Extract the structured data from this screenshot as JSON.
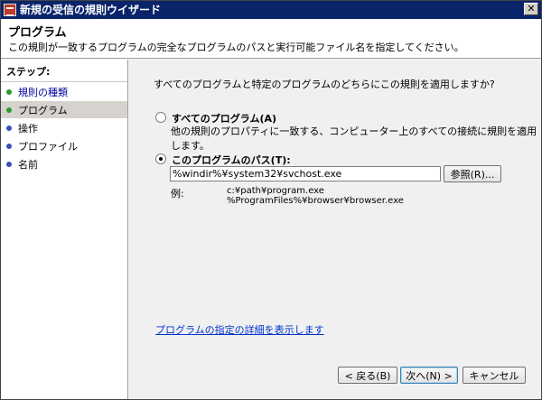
{
  "window": {
    "title": "新規の受信の規則ウイザード",
    "close_glyph": "✕"
  },
  "header": {
    "title": "プログラム",
    "description": "この規則が一致するプログラムの完全なプログラムのパスと実行可能ファイル名を指定してください。"
  },
  "steps": {
    "label": "ステップ:",
    "items": [
      {
        "label": "規則の種類",
        "state": "done",
        "color": "#2e9a2e"
      },
      {
        "label": "プログラム",
        "state": "current",
        "color": "#2e9a2e"
      },
      {
        "label": "操作",
        "state": "pending",
        "color": "#3a4fb8"
      },
      {
        "label": "プロファイル",
        "state": "pending",
        "color": "#3a4fb8"
      },
      {
        "label": "名前",
        "state": "pending",
        "color": "#3a4fb8"
      }
    ]
  },
  "content": {
    "question": "すべてのプログラムと特定のプログラムのどちらにこの規則を適用しますか?",
    "all_programs": {
      "label": "すべてのプログラム(A)",
      "description": "他の規則のプロパティに一致する、コンピューター上のすべての接続に規則を適用します。",
      "checked": false
    },
    "this_program": {
      "label": "このプログラムのパス(T):",
      "checked": true,
      "path_value": "%windir%¥system32¥svchost.exe"
    },
    "browse_label": "参照(R)...",
    "example_label": "例:",
    "example_lines": [
      "c:¥path¥program.exe",
      "%ProgramFiles%¥browser¥browser.exe"
    ],
    "details_link": "プログラムの指定の詳細を表示します"
  },
  "footer": {
    "back_label": "< 戻る(B)",
    "next_label": "次へ(N) >",
    "cancel_label": "キャンセル"
  }
}
